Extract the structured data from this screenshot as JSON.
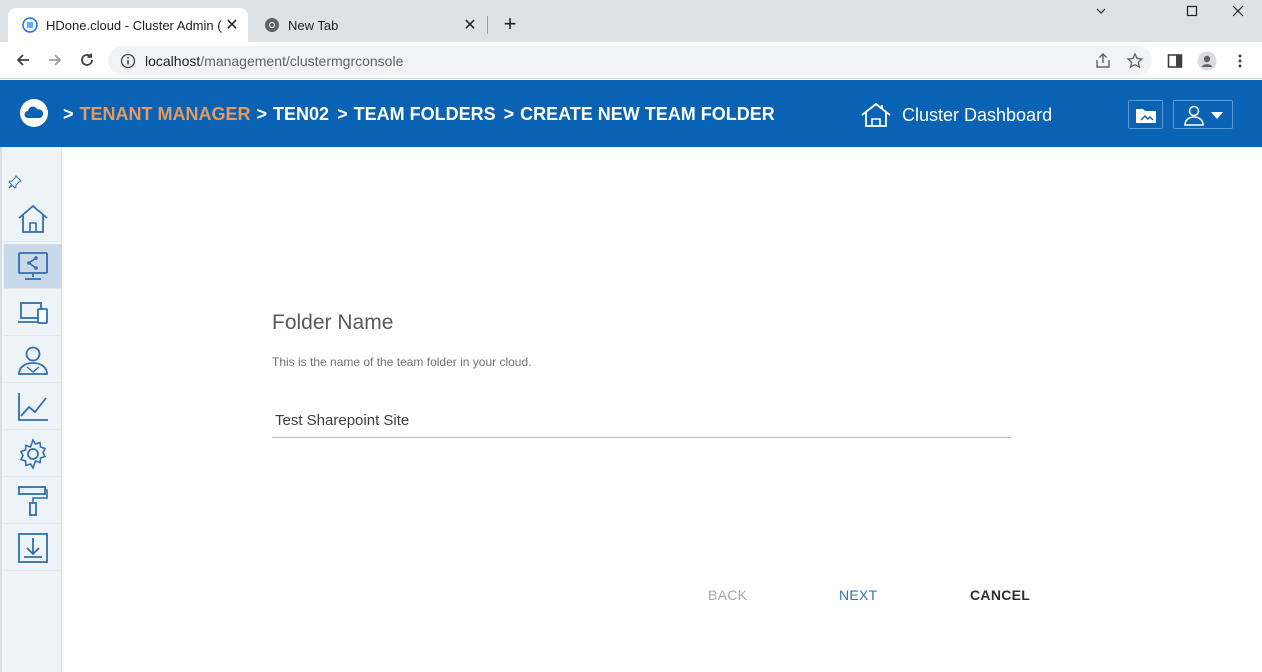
{
  "browser": {
    "tabs": [
      {
        "title": "HDone.cloud - Cluster Admin (jm",
        "close": "✕",
        "favicon": "app-favicon"
      },
      {
        "title": "New Tab",
        "close": "✕",
        "favicon": "chrome-icon"
      }
    ],
    "new_tab": "+",
    "window_controls": {
      "minimize": "⌄",
      "maximize": "☐",
      "close": "✕"
    },
    "url_host": "localhost",
    "url_path": "/management/clustermgrconsole"
  },
  "header": {
    "breadcrumbs": [
      {
        "sep": ">",
        "label": "TENANT MANAGER",
        "link": true
      },
      {
        "sep": ">",
        "label": "TEN02",
        "link": false
      },
      {
        "sep": ">",
        "label": "TEAM FOLDERS",
        "link": false
      },
      {
        "sep": ">",
        "label": "CREATE NEW TEAM FOLDER",
        "link": false
      }
    ],
    "dashboard_label": "Cluster Dashboard",
    "link_color": "#e79a5e",
    "bar_color": "#0a62b4"
  },
  "sidebar": {
    "items": [
      {
        "icon": "home-icon"
      },
      {
        "icon": "shared-folder-icon",
        "active": true
      },
      {
        "icon": "devices-icon"
      },
      {
        "icon": "users-icon"
      },
      {
        "icon": "chart-icon"
      },
      {
        "icon": "settings-icon"
      },
      {
        "icon": "paint-roller-icon"
      },
      {
        "icon": "download-icon"
      }
    ]
  },
  "form": {
    "title": "Folder Name",
    "description": "This is the name of the team folder in your cloud.",
    "value": "Test Sharepoint Site"
  },
  "actions": {
    "back": "BACK",
    "next": "NEXT",
    "cancel": "CANCEL"
  }
}
